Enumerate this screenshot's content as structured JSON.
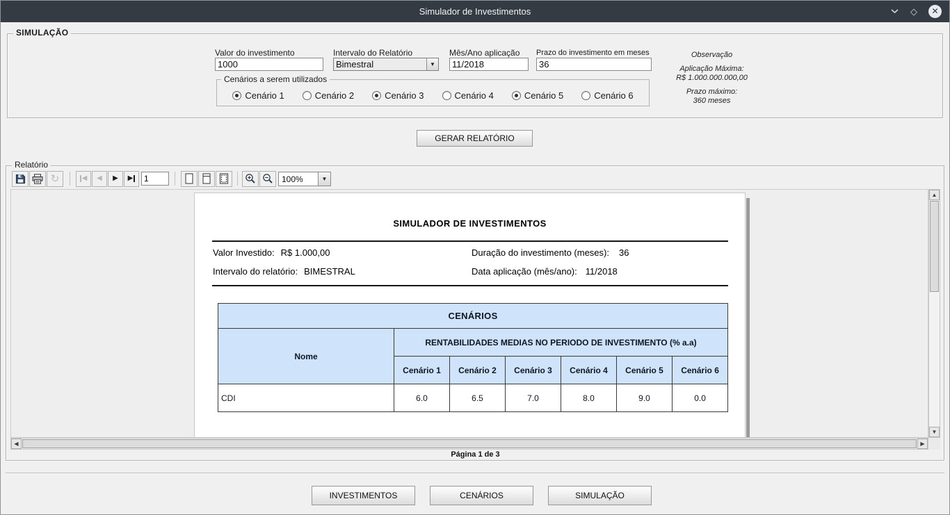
{
  "titlebar": {
    "title": "Simulador de Investimentos"
  },
  "simulacao": {
    "legend": "SIMULAÇÃO",
    "valor": {
      "label": "Valor do investimento",
      "value": "1000"
    },
    "intervalo": {
      "label": "Intervalo do Relatório",
      "value": "Bimestral"
    },
    "mesano": {
      "label": "Mês/Ano aplicação",
      "value": "11/2018"
    },
    "prazo": {
      "label": "Prazo do investimento em meses",
      "value": "36"
    },
    "observacao": {
      "title": "Observação",
      "aplicacao_label": "Aplicação Máxima:",
      "aplicacao_value": "R$ 1.000.000.000,00",
      "prazo_label": "Prazo máximo:",
      "prazo_value": "360 meses"
    },
    "cenarios_legend": "Cenários a serem utilizados",
    "cenarios": [
      {
        "label": "Cenário 1",
        "checked": true
      },
      {
        "label": "Cenário 2",
        "checked": false
      },
      {
        "label": "Cenário 3",
        "checked": true
      },
      {
        "label": "Cenário 4",
        "checked": false
      },
      {
        "label": "Cenário 5",
        "checked": true
      },
      {
        "label": "Cenário 6",
        "checked": false
      }
    ],
    "gerar_label": "GERAR RELATÓRIO"
  },
  "relatorio": {
    "legend": "Relatório",
    "toolbar": {
      "page": "1",
      "zoom": "100%"
    },
    "status": "Página 1 de 3"
  },
  "report": {
    "title": "SIMULADOR DE INVESTIMENTOS",
    "fields": {
      "valor_label": "Valor Investido:",
      "valor_value": "R$ 1.000,00",
      "duracao_label": "Duração do investimento (meses):",
      "duracao_value": "36",
      "intervalo_label": "Intervalo do relatório:",
      "intervalo_value": "BIMESTRAL",
      "data_label": "Data aplicação (mês/ano):",
      "data_value": "11/2018"
    },
    "table": {
      "title": "CENÁRIOS",
      "name_header": "Nome",
      "group_header": "RENTABILIDADES MEDIAS NO PERIODO DE INVESTIMENTO (% a.a)",
      "columns": [
        "Cenário 1",
        "Cenário 2",
        "Cenário 3",
        "Cenário 4",
        "Cenário 5",
        "Cenário 6"
      ],
      "rows": [
        {
          "name": "CDI",
          "values": [
            "6.0",
            "6.5",
            "7.0",
            "8.0",
            "9.0",
            "0.0"
          ]
        }
      ]
    }
  },
  "bottom": {
    "buttons": [
      "INVESTIMENTOS",
      "CENÁRIOS",
      "SIMULAÇÃO"
    ]
  },
  "colors": {
    "titlebar": "#353b43",
    "table_header": "#cfe4fb",
    "page_background": "#ffffff"
  }
}
